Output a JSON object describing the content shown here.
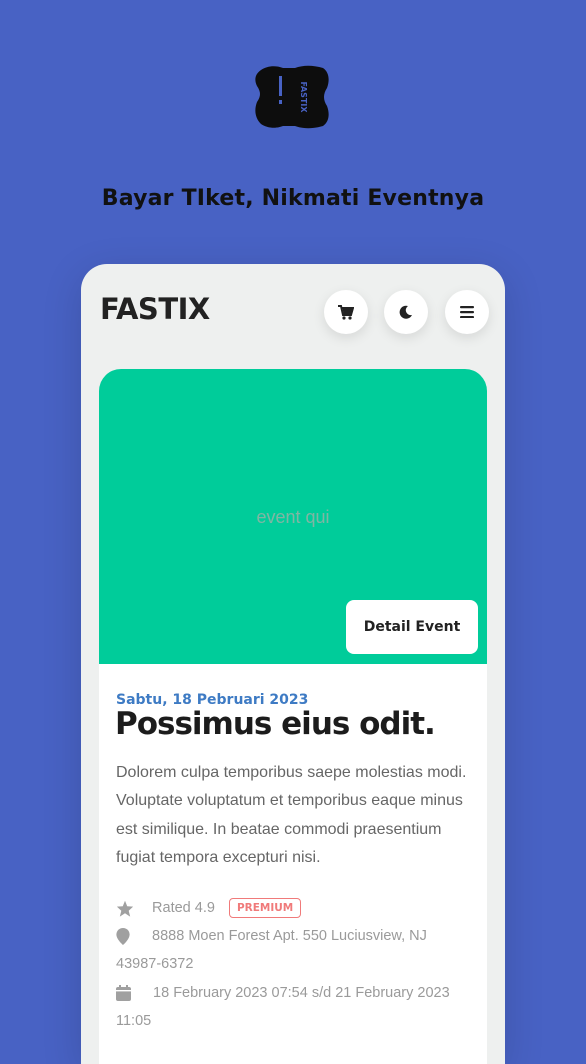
{
  "header": {
    "logo_icon": "fastix-ticket-logo",
    "logo_word": "FASTIX",
    "tagline": "Bayar TIket, Nikmati Eventnya"
  },
  "app": {
    "brand": "FASTIX",
    "actions": [
      {
        "icon": "cart-icon"
      },
      {
        "icon": "moon-icon"
      },
      {
        "icon": "menu-icon"
      }
    ]
  },
  "event": {
    "image_placeholder": "event qui",
    "detail_button": "Detail Event",
    "date": "Sabtu, 18 Pebruari 2023",
    "title": "Possimus eius odit.",
    "description": "Dolorem culpa temporibus saepe molestias modi. Voluptate voluptatum et temporibus eaque minus est similique. In beatae commodi praesentium fugiat tempora excepturi nisi.",
    "rating": "Rated 4.9",
    "badge": "PREMIUM",
    "address": "8888 Moen Forest Apt. 550 Luciusview, NJ 43987-6372",
    "schedule": "18 February 2023 07:54 s/d 21 February 2023 11:05"
  },
  "colors": {
    "background": "#4862c4",
    "hero": "#00cc9a",
    "date": "#3e7bc4",
    "badge": "#f07a7a"
  }
}
